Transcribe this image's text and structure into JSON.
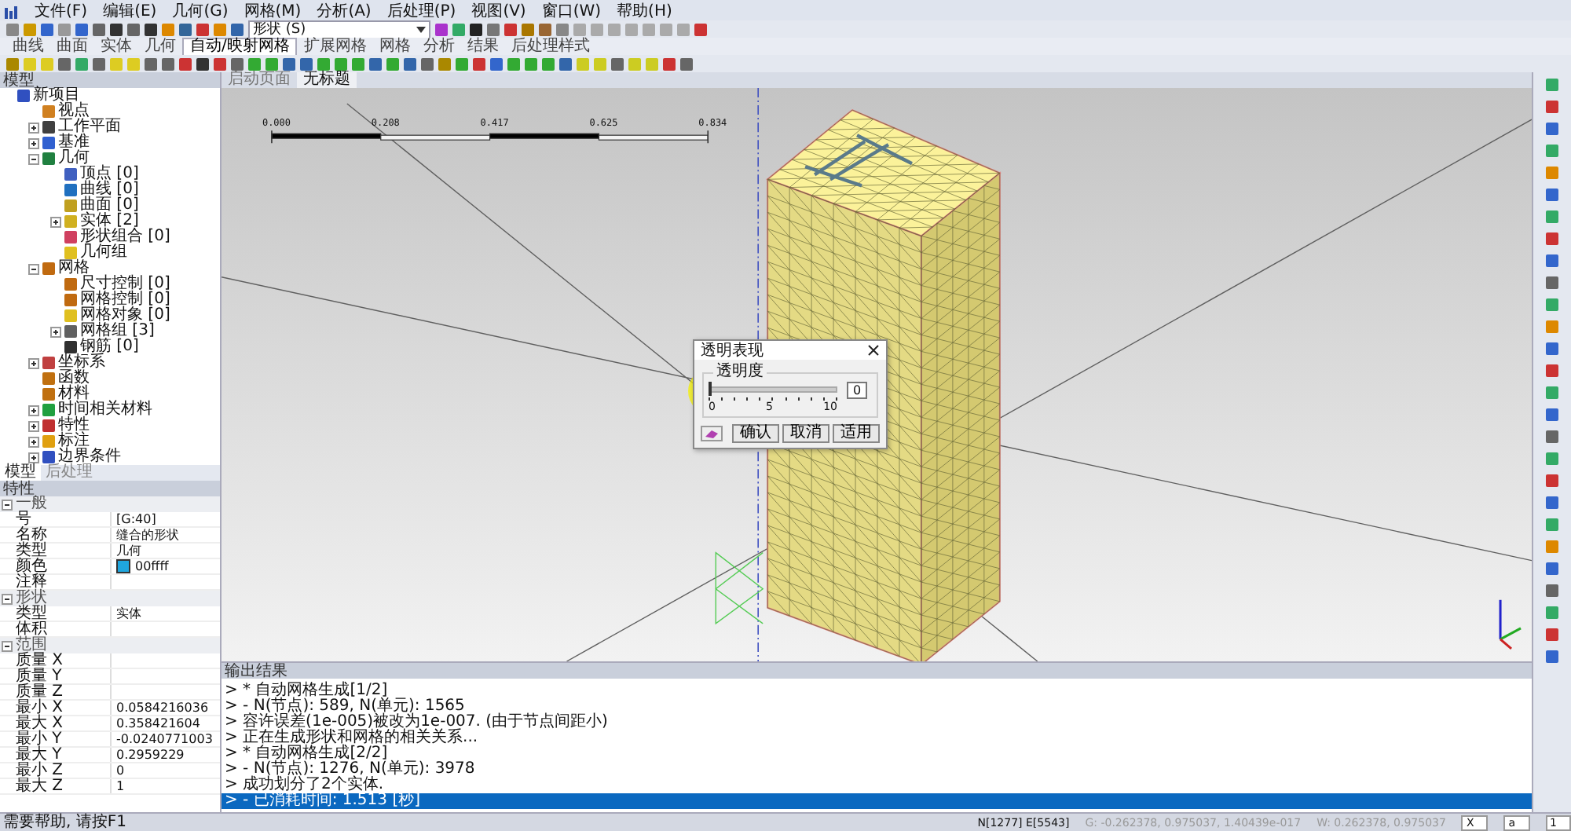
{
  "menu": [
    "文件(F)",
    "编辑(E)",
    "几何(G)",
    "网格(M)",
    "分析(A)",
    "后处理(P)",
    "视图(V)",
    "窗口(W)",
    "帮助(H)"
  ],
  "toolbar": {
    "combo": "形状 (S)"
  },
  "ribbon_tabs": [
    {
      "label": "曲线",
      "selected": false
    },
    {
      "label": "曲面",
      "selected": false
    },
    {
      "label": "实体",
      "selected": false
    },
    {
      "label": "几何",
      "selected": false
    },
    {
      "label": "自动/映射网格",
      "selected": true
    },
    {
      "label": "扩展网格",
      "selected": false
    },
    {
      "label": "网格",
      "selected": false
    },
    {
      "label": "分析",
      "selected": false
    },
    {
      "label": "结果",
      "selected": false
    },
    {
      "label": "后处理样式",
      "selected": false
    }
  ],
  "model_panel": {
    "title": "模型",
    "tree": [
      {
        "label": "新项目",
        "children": [
          {
            "label": "视点"
          },
          {
            "label": "工作平面",
            "expanded": false
          },
          {
            "label": "基准",
            "expanded": false
          },
          {
            "label": "几何",
            "expanded": true,
            "children": [
              {
                "label": "顶点 [0]"
              },
              {
                "label": "曲线 [0]"
              },
              {
                "label": "曲面 [0]"
              },
              {
                "label": "实体 [2]",
                "expanded": false
              },
              {
                "label": "形状组合 [0]"
              },
              {
                "label": "几何组"
              }
            ]
          },
          {
            "label": "网格",
            "expanded": true,
            "children": [
              {
                "label": "尺寸控制 [0]"
              },
              {
                "label": "网格控制 [0]"
              },
              {
                "label": "网格对象 [0]"
              },
              {
                "label": "网格组 [3]",
                "expanded": false
              },
              {
                "label": "钢筋 [0]"
              }
            ]
          },
          {
            "label": "坐标系",
            "expanded": false
          },
          {
            "label": "函数"
          },
          {
            "label": "材料"
          },
          {
            "label": "时间相关材料",
            "expanded": false
          },
          {
            "label": "特性",
            "expanded": false
          },
          {
            "label": "标注",
            "expanded": false
          },
          {
            "label": "边界条件",
            "expanded": false
          }
        ]
      }
    ],
    "tabs": [
      {
        "label": "模型",
        "selected": true
      },
      {
        "label": "后处理",
        "selected": false
      }
    ]
  },
  "properties_panel": {
    "title": "特性",
    "groups": [
      {
        "label": "一般",
        "expanded": true,
        "rows": [
          {
            "name": "号",
            "value": "[G:40]"
          },
          {
            "name": "名称",
            "value": "缝合的形状"
          },
          {
            "name": "类型",
            "value": "几何"
          },
          {
            "name": "颜色",
            "value": "00ffff",
            "color": "#1fa6de"
          },
          {
            "name": "注释",
            "value": ""
          }
        ]
      },
      {
        "label": "形状",
        "expanded": true,
        "rows": [
          {
            "name": "类型",
            "value": "实体"
          },
          {
            "name": "体积",
            "value": ""
          }
        ]
      },
      {
        "label": "范围",
        "expanded": true,
        "rows": [
          {
            "name": "质量 X",
            "value": ""
          },
          {
            "name": "质量 Y",
            "value": ""
          },
          {
            "name": "质量 Z",
            "value": ""
          },
          {
            "name": "最小 X",
            "value": "0.0584216036"
          },
          {
            "name": "最大 X",
            "value": "0.358421604"
          },
          {
            "name": "最小 Y",
            "value": "-0.0240771003"
          },
          {
            "name": "最大 Y",
            "value": "0.2959229"
          },
          {
            "name": "最小 Z",
            "value": "0"
          },
          {
            "name": "最大 Z",
            "value": "1"
          }
        ]
      }
    ]
  },
  "doc_tabs": [
    {
      "label": "启动页面",
      "selected": false
    },
    {
      "label": "无标题",
      "selected": true
    }
  ],
  "scale_bar": [
    "0.000",
    "0.208",
    "0.417",
    "0.625",
    "0.834"
  ],
  "dialog": {
    "title": "透明表现",
    "group": "透明度",
    "value": "0",
    "level": 0,
    "ticks": [
      "0",
      "5",
      "10"
    ],
    "buttons": [
      "确认",
      "取消",
      "适用"
    ]
  },
  "output": {
    "title": "输出结果",
    "lines": [
      {
        "text": "> * 自动网格生成[1/2]",
        "selected": false
      },
      {
        "text": "> - N(节点): 589, N(单元): 1565",
        "selected": false
      },
      {
        "text": "> 容许误差(1e-005)被改为1e-007. (由于节点间距小)",
        "selected": false
      },
      {
        "text": "> 正在生成形状和网格的相关关系...",
        "selected": false
      },
      {
        "text": "> * 自动网格生成[2/2]",
        "selected": false
      },
      {
        "text": "> - N(节点): 1276, N(单元): 3978",
        "selected": false
      },
      {
        "text": "> 成功划分了2个实体.",
        "selected": false
      },
      {
        "text": "> - 已消耗时间: 1.513 [秒]",
        "selected": true
      }
    ]
  },
  "status_bar": {
    "help": "需要帮助, 请按F1",
    "counts": "N[1277] E[5543]",
    "global": "G: -0.262378, 0.975037, 1.40439e-017",
    "work": "W: 0.262378, 0.975037",
    "selects": [
      "X",
      "a",
      "1"
    ]
  }
}
